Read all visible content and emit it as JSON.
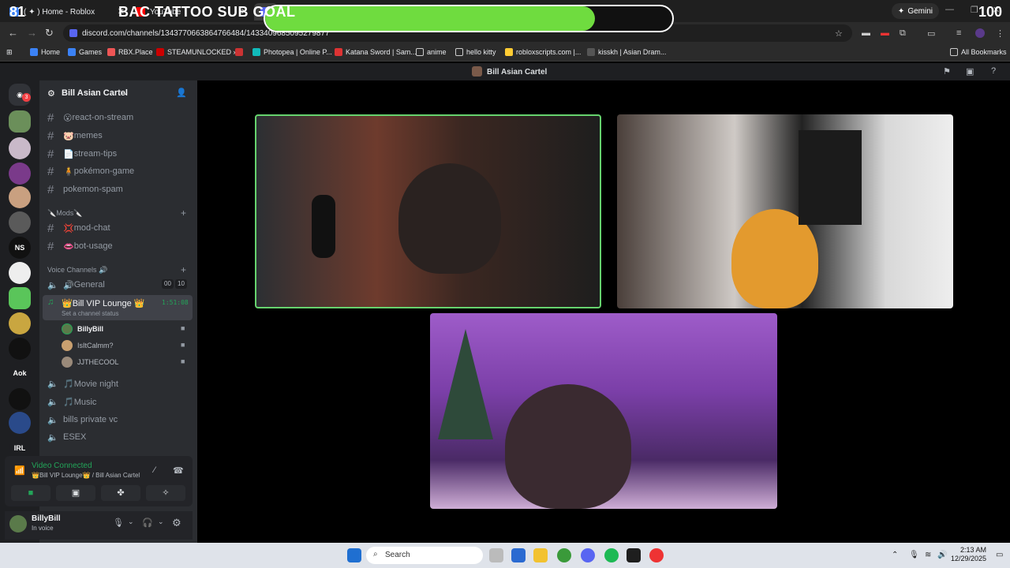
{
  "browser": {
    "tabs": [
      {
        "title": "( ✦ ) Home - Roblox"
      },
      {
        "title": "YouTube"
      }
    ],
    "gemini_label": "Gemini",
    "url": "discord.com/channels/1343770663864766484/1433409685095279877",
    "bookmarks": [
      "Home",
      "Games",
      "RBX.Place",
      "STEAMUNLOCKED »...",
      "Photopea | Online P...",
      "Katana Sword | Sam...",
      "anime",
      "hello kitty",
      "robloxscripts.com |...",
      "kisskh | Asian Dram..."
    ],
    "all_bookmarks_label": "All Bookmarks"
  },
  "overlay": {
    "current": "81",
    "title": "BAC TATTOO SUB GOAL",
    "goal": "100",
    "progress": 0.81,
    "fill_color": "#6fdc3f"
  },
  "discord": {
    "window_title": "Bill Asian Cartel",
    "server_name": "Bill Asian Cartel",
    "unread_count": "3",
    "rail_labels": [
      "NS",
      "Aok",
      "IRL"
    ],
    "channels": [
      {
        "emoji": "😮",
        "name": "react-on-stream"
      },
      {
        "emoji": "🐷",
        "name": "memes"
      },
      {
        "emoji": "📄",
        "name": "stream-tips"
      },
      {
        "emoji": "🧍",
        "name": "pokémon-game"
      },
      {
        "emoji": "",
        "name": "pokemon-spam"
      }
    ],
    "mods_category": "🔪Mods🔪",
    "mod_channels": [
      {
        "emoji": "💢",
        "name": "mod-chat"
      },
      {
        "emoji": "👄",
        "name": "bot-usage"
      }
    ],
    "voice_category": "Voice Channels 🔊",
    "voice_channels": [
      {
        "emoji": "🔊",
        "name": "General",
        "counts": [
          "00",
          "10"
        ]
      },
      {
        "emoji": "👑",
        "name": "Bill VIP Lounge 👑",
        "timer": "1:51:08",
        "status": "Set a channel status"
      }
    ],
    "voice_users": [
      "BillyBill",
      "IsItCalmm?",
      "JJTHECOOL"
    ],
    "more_voice_channels": [
      "🎵Movie night",
      "🎵Music",
      "bills private vc",
      "ESEX"
    ],
    "voice_panel": {
      "status": "Video Connected",
      "channel": "👑Bill VIP Lounge👑 / Bill Asian Cartel"
    },
    "user": {
      "name": "BillyBill",
      "status": "In voice"
    }
  },
  "taskbar": {
    "search_placeholder": "Search",
    "time": "2:13 AM",
    "date": "12/29/2025"
  }
}
